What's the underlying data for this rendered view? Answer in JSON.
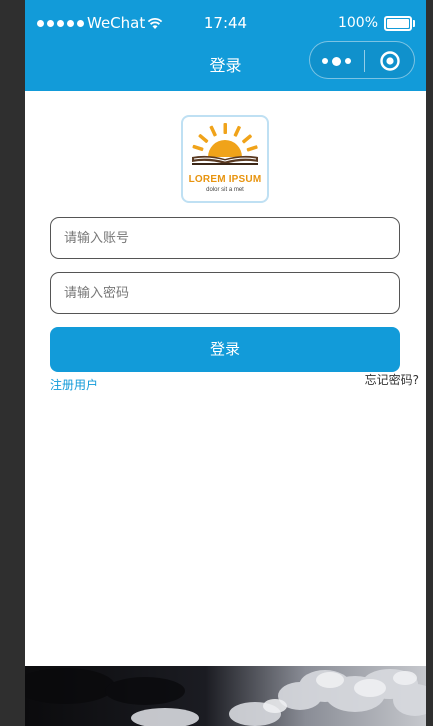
{
  "status_bar": {
    "carrier": "WeChat",
    "time": "17:44",
    "battery": "100%",
    "battery_level": 1.0
  },
  "nav_bar": {
    "title": "登录",
    "more_icon": "more-dots-icon",
    "close_icon": "target-close-icon"
  },
  "logo": {
    "title": "LOREM IPSUM",
    "subtitle": "dolor sit a met",
    "icon": "sun-book-icon"
  },
  "form": {
    "account_placeholder": "请输入账号",
    "account_value": "",
    "password_placeholder": "请输入密码",
    "password_value": "",
    "login_label": "登录",
    "register_label": "注册用户",
    "forgot_label": "忘记密码?"
  },
  "colors": {
    "accent": "#129bd9",
    "logo_orange": "#e8940f",
    "background": "#2f2f2f"
  }
}
